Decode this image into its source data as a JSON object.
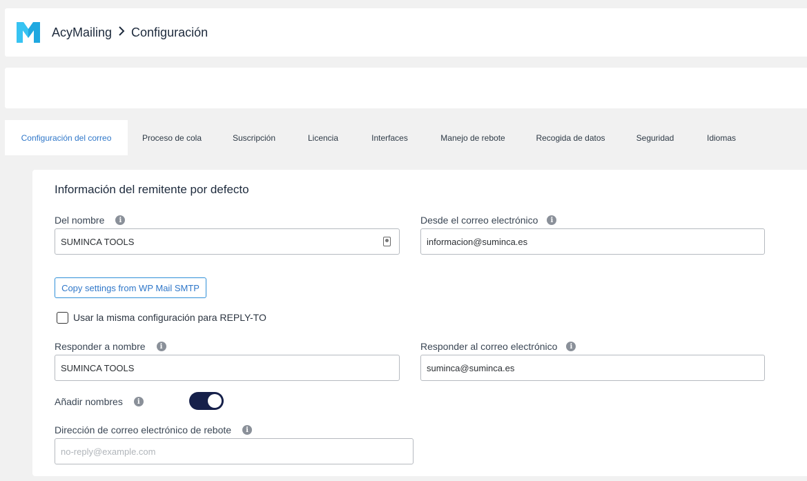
{
  "header": {
    "app_name": "AcyMailing",
    "page": "Configuración"
  },
  "tabs": [
    {
      "label": "Configuración del correo",
      "active": true
    },
    {
      "label": "Proceso de cola"
    },
    {
      "label": "Suscripción"
    },
    {
      "label": "Licencia"
    },
    {
      "label": "Interfaces"
    },
    {
      "label": "Manejo de rebote"
    },
    {
      "label": "Recogida de datos"
    },
    {
      "label": "Seguridad"
    },
    {
      "label": "Idiomas"
    }
  ],
  "section": {
    "title": "Información del remitente por defecto"
  },
  "fields": {
    "from_name": {
      "label": "Del nombre",
      "value": "SUMINCA TOOLS"
    },
    "from_email": {
      "label": "Desde el correo electrónico",
      "value": "informacion@suminca.es"
    },
    "copy_button": "Copy settings from WP Mail SMTP",
    "same_replyto": {
      "label": "Usar la misma configuración para REPLY-TO",
      "checked": false
    },
    "reply_name": {
      "label": "Responder a nombre",
      "value": "SUMINCA TOOLS"
    },
    "reply_email": {
      "label": "Responder al correo electrónico",
      "value": "suminca@suminca.es"
    },
    "add_names": {
      "label": "Añadir nombres",
      "enabled": true
    },
    "bounce_email": {
      "label": "Dirección de correo electrónico de rebote",
      "placeholder": "no-reply@example.com",
      "value": ""
    }
  },
  "colors": {
    "accent": "#2f77c9",
    "toggle_on": "#16204a",
    "logo": "#1fa8e0"
  },
  "icons": {
    "info": "info-icon",
    "contact": "contact-card-icon",
    "breadcrumb_sep": "chevron-right-icon"
  }
}
